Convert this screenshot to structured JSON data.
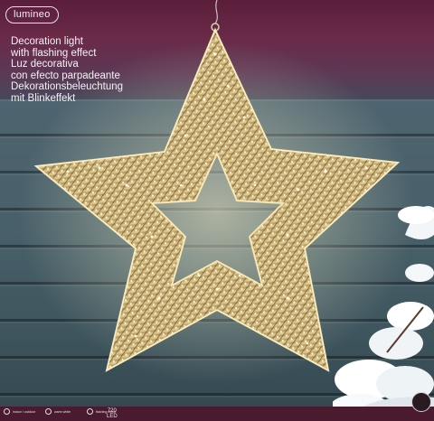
{
  "brand": {
    "logo_text": "lumineo"
  },
  "product": {
    "description_lines": [
      "Decoration light",
      "with flashing effect",
      "Luz decorativa",
      "con efecto parpadeante",
      "Dekorationsbeleuchtung",
      "mit Blinkeffekt"
    ],
    "led_count": "720",
    "led_unit": "LED"
  },
  "icons": [
    {
      "name": "indoor-outdoor-icon",
      "label": "indoor / outdoor"
    },
    {
      "name": "warm-white-icon",
      "label": "warm white"
    },
    {
      "name": "flashing-effect-icon",
      "label": "flashing effect"
    }
  ],
  "colors": {
    "sky_top": "#5a1e3a",
    "siding": "#486069",
    "star_gold": "#d8c089",
    "light_glow": "#fff3c4",
    "bottom_strip": "#4a1a2e"
  }
}
